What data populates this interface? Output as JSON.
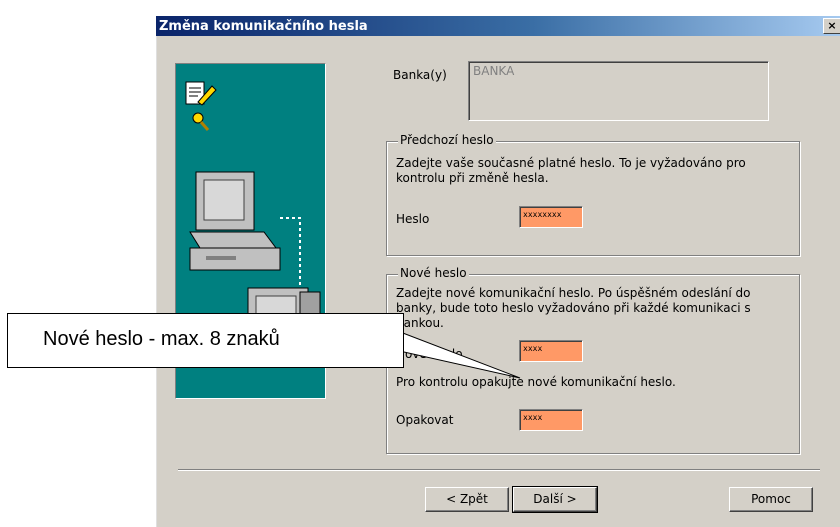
{
  "window": {
    "title": "Změna komunikačního hesla",
    "close_label": "×"
  },
  "bank": {
    "label": "Banka(y)",
    "value": "BANKA"
  },
  "previous_password": {
    "legend": "Předchozí heslo",
    "description_line1": "Zadejte vaše současné platné heslo. To je vyžadováno pro",
    "description_line2": "kontrolu při změně hesla.",
    "field_label": "Heslo",
    "masked_value": "xxxxxxxx"
  },
  "new_password": {
    "legend": "Nové heslo",
    "description_line1": "Zadejte nové komunikační heslo. Po úspěšném odeslání do",
    "description_line2": "banky, bude toto heslo vyžadováno při každé komunikaci s",
    "description_line3": "bankou.",
    "field_label": "Nové heslo",
    "masked_value": "xxxx",
    "confirm_text": "Pro kontrolu opakujte nové komunikační heslo.",
    "confirm_label": "Opakovat",
    "confirm_masked_value": "xxxx"
  },
  "buttons": {
    "back": "< Zpět",
    "next": "Další >",
    "help": "Pomoc"
  },
  "callout": {
    "text": "Nové heslo - max. 8 znaků"
  },
  "colors": {
    "title_start": "#0a246a",
    "title_end": "#a6caf0",
    "panel": "#008080",
    "password_field": "#ff9966"
  }
}
